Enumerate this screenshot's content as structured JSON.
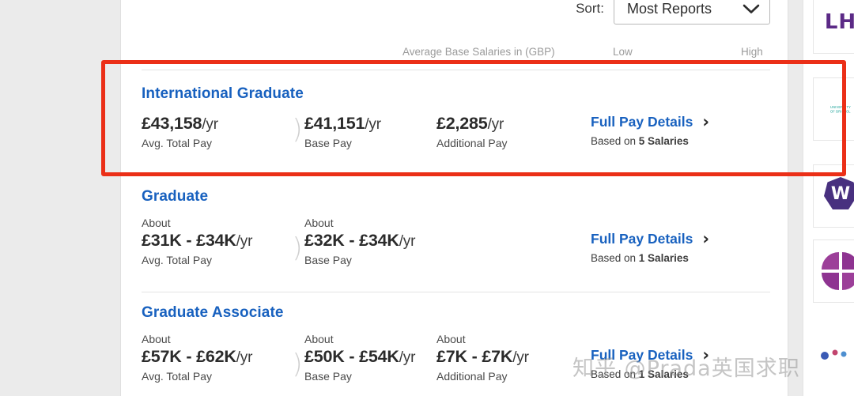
{
  "toolbar": {
    "sort_label": "Sort:",
    "sort_value": "Most Reports",
    "sort_caret_icon": "chevron-down-icon"
  },
  "column_headers": {
    "average": "Average Base Salaries in (GBP)",
    "low": "Low",
    "high": "High"
  },
  "salary_cards": [
    {
      "title": "International Graduate",
      "total_pay": {
        "about": "",
        "amount": "£43,158",
        "unit": "/yr",
        "label": "Avg. Total Pay"
      },
      "base_pay": {
        "about": "",
        "amount": "£41,151",
        "unit": "/yr",
        "label": "Base Pay"
      },
      "additional_pay": {
        "about": "",
        "amount": "£2,285",
        "unit": "/yr",
        "label": "Additional Pay"
      },
      "details_link": "Full Pay Details",
      "based_on_prefix": "Based on ",
      "based_on_count": "5 Salaries"
    },
    {
      "title": "Graduate",
      "total_pay": {
        "about": "About",
        "amount": "£31K - £34K",
        "unit": "/yr",
        "label": "Avg. Total Pay"
      },
      "base_pay": {
        "about": "About",
        "amount": "£32K - £34K",
        "unit": "/yr",
        "label": "Base Pay"
      },
      "additional_pay": null,
      "details_link": "Full Pay Details",
      "based_on_prefix": "Based on ",
      "based_on_count": "1 Salaries"
    },
    {
      "title": "Graduate Associate",
      "total_pay": {
        "about": "About",
        "amount": "£57K - £62K",
        "unit": "/yr",
        "label": "Avg. Total Pay"
      },
      "base_pay": {
        "about": "About",
        "amount": "£50K - £54K",
        "unit": "/yr",
        "label": "Base Pay"
      },
      "additional_pay": {
        "about": "About",
        "amount": "£7K - £7K",
        "unit": "/yr",
        "label": "Additional Pay"
      },
      "details_link": "Full Pay Details",
      "based_on_prefix": "Based on ",
      "based_on_count": "1 Salaries"
    }
  ],
  "right_rail": {
    "logos": [
      {
        "name": "lh-logo",
        "text": "LH",
        "style": "text"
      },
      {
        "name": "teal-wordmark-logo",
        "text": "UNIVERSITY\nOF BRISTOL",
        "style": "teal-text"
      },
      {
        "name": "w-badge-logo",
        "text": "W",
        "style": "badge"
      },
      {
        "name": "pinwheel-logo",
        "text": "",
        "style": "pinwheel"
      }
    ]
  },
  "annotation": {
    "highlight_color": "#eb2f17"
  },
  "watermark": {
    "text": "知乎 @Prada英国求职"
  },
  "colors": {
    "link_blue": "#1861bf",
    "page_background": "#ebebeb",
    "panel_background": "#ffffff",
    "highlight_red": "#eb2f17"
  }
}
